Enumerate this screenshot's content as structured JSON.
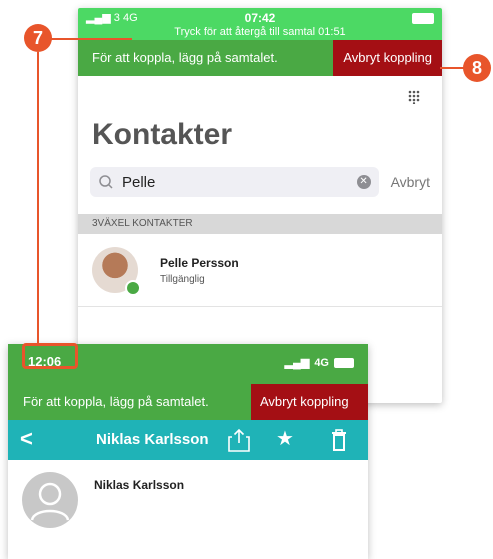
{
  "back_screen": {
    "status_bar": {
      "signal": "3",
      "network": "4G",
      "time": "07:42",
      "call_banner": "Tryck för att återgå till samtal 01:51"
    },
    "transfer_bar": {
      "message": "För att koppla, lägg på samtalet.",
      "cancel_label": "Avbryt koppling"
    },
    "title": "Kontakter",
    "search": {
      "value": "Pelle",
      "cancel_label": "Avbryt"
    },
    "section_header": "3VÄXEL KONTAKTER",
    "contacts": [
      {
        "name": "Pelle Persson",
        "status": "Tillgänglig"
      }
    ]
  },
  "front_screen": {
    "status_bar": {
      "time": "12:06",
      "network": "4G"
    },
    "transfer_bar": {
      "message": "För att koppla, lägg på samtalet.",
      "cancel_label": "Avbryt koppling"
    },
    "nav": {
      "title": "Niklas Karlsson"
    },
    "contact_name": "Niklas Karlsson"
  },
  "callouts": {
    "left": "7",
    "right": "8"
  },
  "colors": {
    "green": "#4aa944",
    "status_green": "#4cd964",
    "red": "#a40f14",
    "teal": "#1fb3b7",
    "callout_orange": "#e8552b"
  }
}
